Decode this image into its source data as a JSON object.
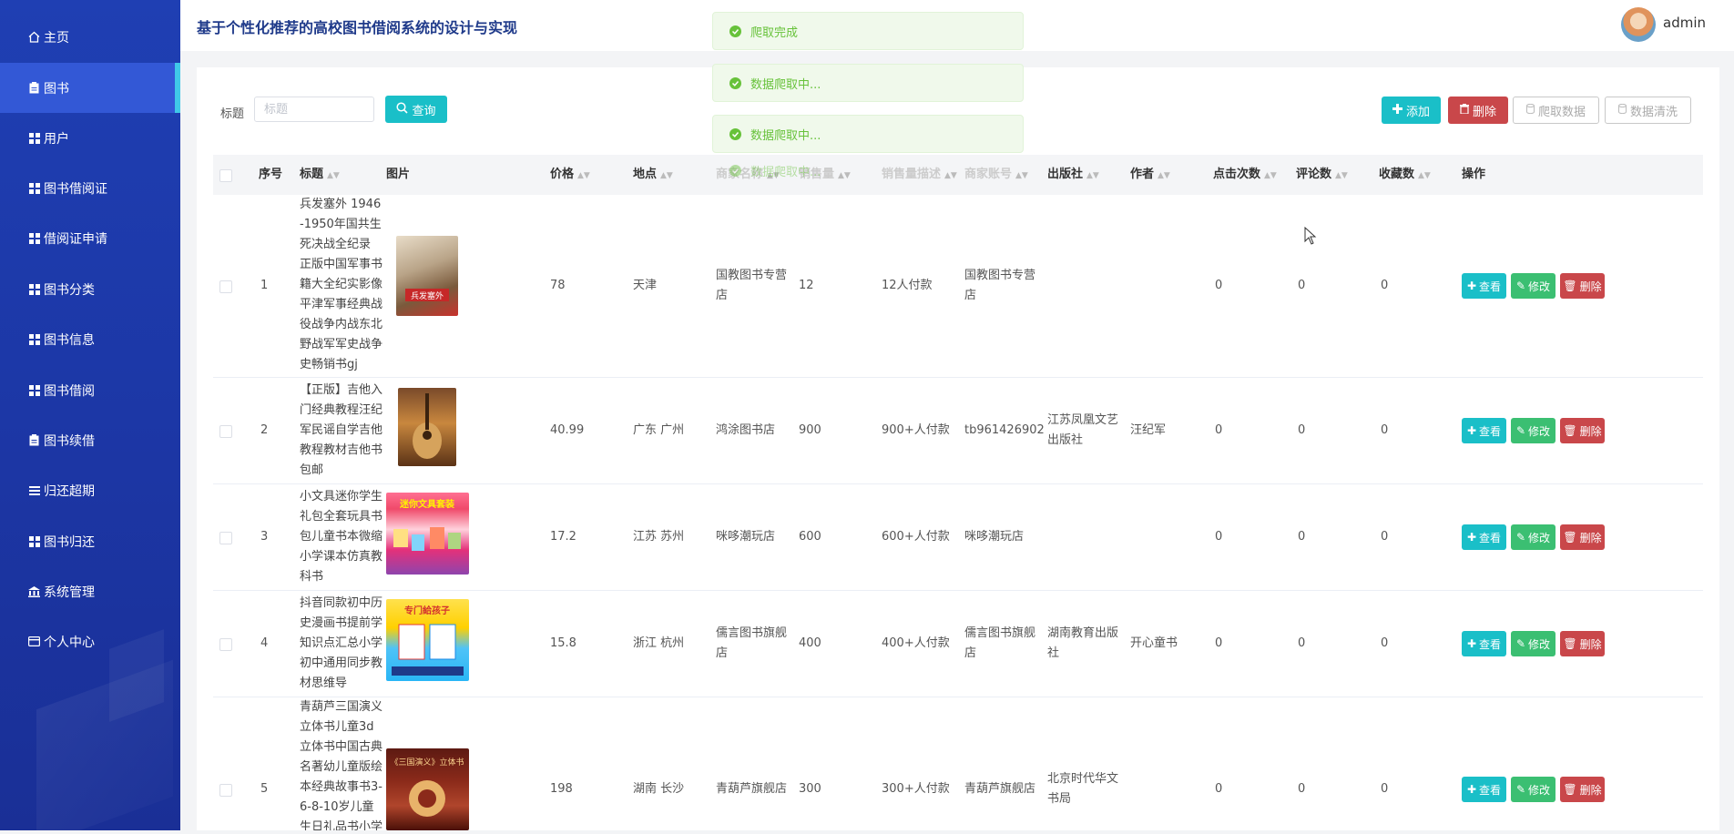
{
  "sidebar": {
    "items": [
      {
        "label": "主页",
        "icon": "home-icon"
      },
      {
        "label": "图书",
        "icon": "clipboard-icon",
        "active": true
      },
      {
        "label": "用户",
        "icon": "grid-icon"
      },
      {
        "label": "图书借阅证",
        "icon": "grid-icon"
      },
      {
        "label": "借阅证申请",
        "icon": "grid-icon"
      },
      {
        "label": "图书分类",
        "icon": "grid-icon"
      },
      {
        "label": "图书信息",
        "icon": "grid-icon"
      },
      {
        "label": "图书借阅",
        "icon": "grid-icon"
      },
      {
        "label": "图书续借",
        "icon": "clipboard-icon"
      },
      {
        "label": "归还超期",
        "icon": "list-icon"
      },
      {
        "label": "图书归还",
        "icon": "grid-icon"
      },
      {
        "label": "系统管理",
        "icon": "bank-icon"
      },
      {
        "label": "个人中心",
        "icon": "card-icon"
      }
    ]
  },
  "header": {
    "title": "基于个性化推荐的高校图书借阅系统的设计与实现",
    "username": "admin"
  },
  "toasts": [
    {
      "text": "爬取完成"
    },
    {
      "text": "数据爬取中..."
    },
    {
      "text": "数据爬取中..."
    },
    {
      "text": "数据爬取中..."
    }
  ],
  "search": {
    "label": "标题",
    "placeholder": "标题",
    "query_label": "查询"
  },
  "toolbar": {
    "add_label": "添加",
    "delete_label": "删除",
    "crawl_label": "爬取数据",
    "clean_label": "数据清洗"
  },
  "table": {
    "headers": {
      "index": "序号",
      "title": "标题",
      "image": "图片",
      "price": "价格",
      "location": "地点",
      "shop": "商家名称",
      "sales": "销售量",
      "sales_desc": "销售量描述",
      "shop_account": "商家账号",
      "publisher": "出版社",
      "author": "作者",
      "clicks": "点击次数",
      "comments": "评论数",
      "favorites": "收藏数",
      "actions": "操作"
    },
    "action_labels": {
      "view": "查看",
      "edit": "修改",
      "delete": "删除"
    },
    "rows": [
      {
        "index": "1",
        "title": "兵发塞外 1946-1950年国共生死决战全纪录 正版中国军事书籍大全纪实影像平津军事经典战役战争内战东北野战军军史战争史畅销书gj",
        "price": "78",
        "location": "天津",
        "shop": "国教图书专营店",
        "sales": "12",
        "sales_desc": "12人付款",
        "shop_account": "国教图书专营店",
        "publisher": "",
        "author": "",
        "clicks": "0",
        "comments": "0",
        "favorites": "0",
        "cover_text": "兵发塞外"
      },
      {
        "index": "2",
        "title": "【正版】吉他入门经典教程汪纪军民谣自学吉他教程教材吉他书包邮",
        "price": "40.99",
        "location": "广东 广州",
        "shop": "鸿涂图书店",
        "sales": "900",
        "sales_desc": "900+人付款",
        "shop_account": "tb961426902",
        "publisher": "江苏凤凰文艺出版社",
        "author": "汪纪军",
        "clicks": "0",
        "comments": "0",
        "favorites": "0",
        "cover_text": "吉他"
      },
      {
        "index": "3",
        "title": "小文具迷你学生礼包全套玩具书包儿童书本微缩小学课本仿真教科书",
        "price": "17.2",
        "location": "江苏 苏州",
        "shop": "咪哆潮玩店",
        "sales": "600",
        "sales_desc": "600+人付款",
        "shop_account": "咪哆潮玩店",
        "publisher": "",
        "author": "",
        "clicks": "0",
        "comments": "0",
        "favorites": "0",
        "cover_text": "迷你文具套装"
      },
      {
        "index": "4",
        "title": "抖音同款初中历史漫画书提前学知识点汇总小学初中通用同步教材思维导",
        "price": "15.8",
        "location": "浙江 杭州",
        "shop": "儒言图书旗舰店",
        "sales": "400",
        "sales_desc": "400+人付款",
        "shop_account": "儒言图书旗舰店",
        "publisher": "湖南教育出版社",
        "author": "开心童书",
        "clicks": "0",
        "comments": "0",
        "favorites": "0",
        "cover_text": "专门給孩子"
      },
      {
        "index": "5",
        "title": "青葫芦三国演义立体书儿童3d立体书中国古典名著幼儿童版绘本经典故事书3-6-8-10岁儿童生日礼品书小学",
        "price": "198",
        "location": "湖南 长沙",
        "shop": "青葫芦旗舰店",
        "sales": "300",
        "sales_desc": "300+人付款",
        "shop_account": "青葫芦旗舰店",
        "publisher": "北京时代华文书局",
        "author": "",
        "clicks": "0",
        "comments": "0",
        "favorites": "0",
        "cover_text": "《三国演义》立体书"
      }
    ]
  },
  "colors": {
    "sidebar_bg": "#1f3fb3",
    "sidebar_active": "#3358d6",
    "accent_teal": "#1abfc8",
    "danger": "#c9474a",
    "success": "#3bbf72",
    "toast_text": "#67c23a"
  }
}
